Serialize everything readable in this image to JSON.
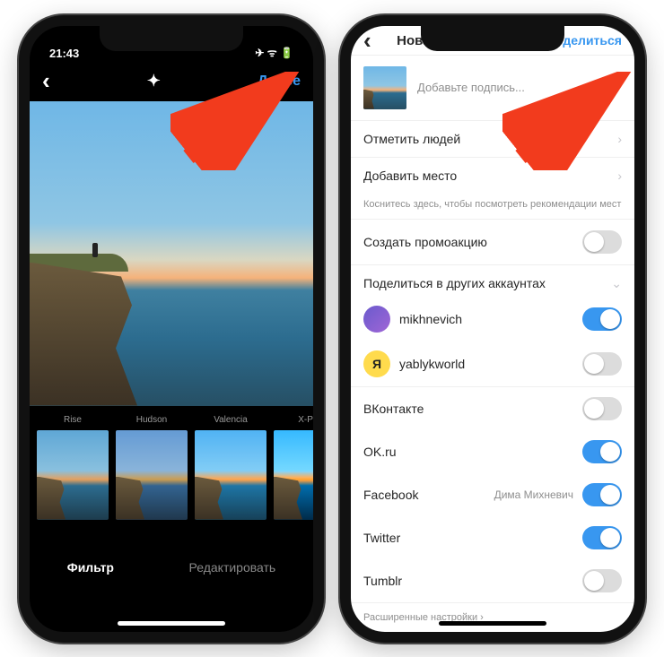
{
  "left": {
    "status_time": "21:43",
    "status_icons": "✈ ᯤ 🔋",
    "nav_back": "‹",
    "nav_wand": "✦",
    "nav_next": "Далее",
    "filters": [
      {
        "label": "Rise"
      },
      {
        "label": "Hudson"
      },
      {
        "label": "Valencia"
      },
      {
        "label": "X-Pro"
      }
    ],
    "tab_filter": "Фильтр",
    "tab_edit": "Редактировать"
  },
  "right": {
    "nav_back": "‹",
    "nav_title": "Новая публикация",
    "nav_share": "Поделиться",
    "caption_placeholder": "Добавьте подпись...",
    "tag_people": "Отметить людей",
    "add_location": "Добавить место",
    "location_hint": "Коснитесь здесь, чтобы посмотреть рекомендации мест",
    "create_promo": "Создать промоакцию",
    "share_other": "Поделиться в других аккаунтах",
    "accounts": [
      {
        "name": "mikhnevich",
        "on": true,
        "avatar": "grad"
      },
      {
        "name": "yablykworld",
        "on": false,
        "avatar": "yellow",
        "initial": "Я"
      }
    ],
    "networks": [
      {
        "name": "ВКонтакте",
        "sub": "",
        "on": false
      },
      {
        "name": "OK.ru",
        "sub": "",
        "on": true
      },
      {
        "name": "Facebook",
        "sub": "Дима Михневич",
        "on": true
      },
      {
        "name": "Twitter",
        "sub": "",
        "on": true
      },
      {
        "name": "Tumblr",
        "sub": "",
        "on": false
      }
    ],
    "advanced": "Расширенные настройки  ›"
  }
}
